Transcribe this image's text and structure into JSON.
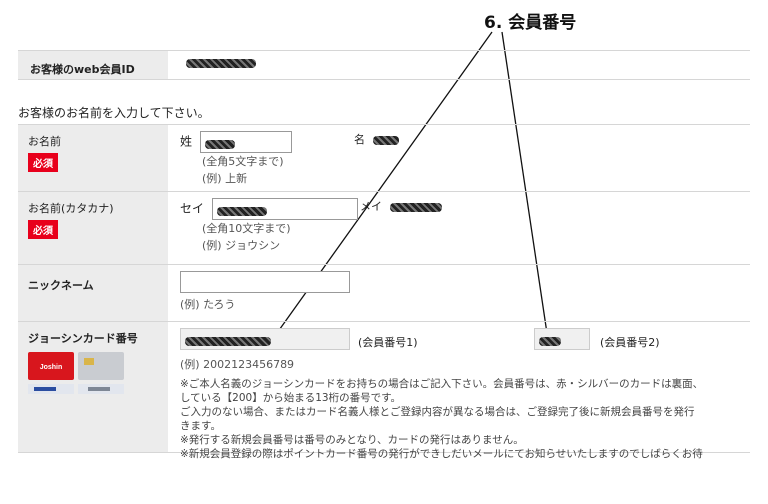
{
  "annotation": {
    "label": "6. 会員番号"
  },
  "web_id": {
    "label": "お客様のweb会員ID"
  },
  "intro": "お客様のお名前を入力して下さい。",
  "required_badge": "必須",
  "name": {
    "label": "お名前",
    "sei_label": "姓",
    "mei_label": "名",
    "hint1": "(全角5文字まで)",
    "hint2": "(例) 上新"
  },
  "kana": {
    "label": "お名前(カタカナ)",
    "sei_label": "セイ",
    "mei_label": "メイ",
    "hint1": "(全角10文字まで)",
    "hint2": "(例) ジョウシン"
  },
  "nickname": {
    "label": "ニックネーム",
    "hint": "(例) たろう"
  },
  "card": {
    "label": "ジョーシンカード番号",
    "field1_label": "(会員番号1)",
    "field2_label": "(会員番号2)",
    "example": "(例) 2002123456789",
    "card_logo": "Joshin",
    "notes": [
      "※ご本人名義のジョーシンカードをお持ちの場合はご記入下さい。会員番号は、赤・シルバーのカードは裏面、",
      "  している【200】から始まる13桁の番号です。",
      "  ご入力のない場合、またはカード名義人様とご登録内容が異なる場合は、ご登録完了後に新規会員番号を発行",
      "  きます。",
      "※発行する新規会員番号は番号のみとなり、カードの発行はありません。",
      "※新規会員登録の際はポイントカード番号の発行ができしだいメールにてお知らせいたしますのでしばらくお待"
    ]
  },
  "colors": {
    "required": "#e8001c",
    "label_bg": "#ececec"
  }
}
